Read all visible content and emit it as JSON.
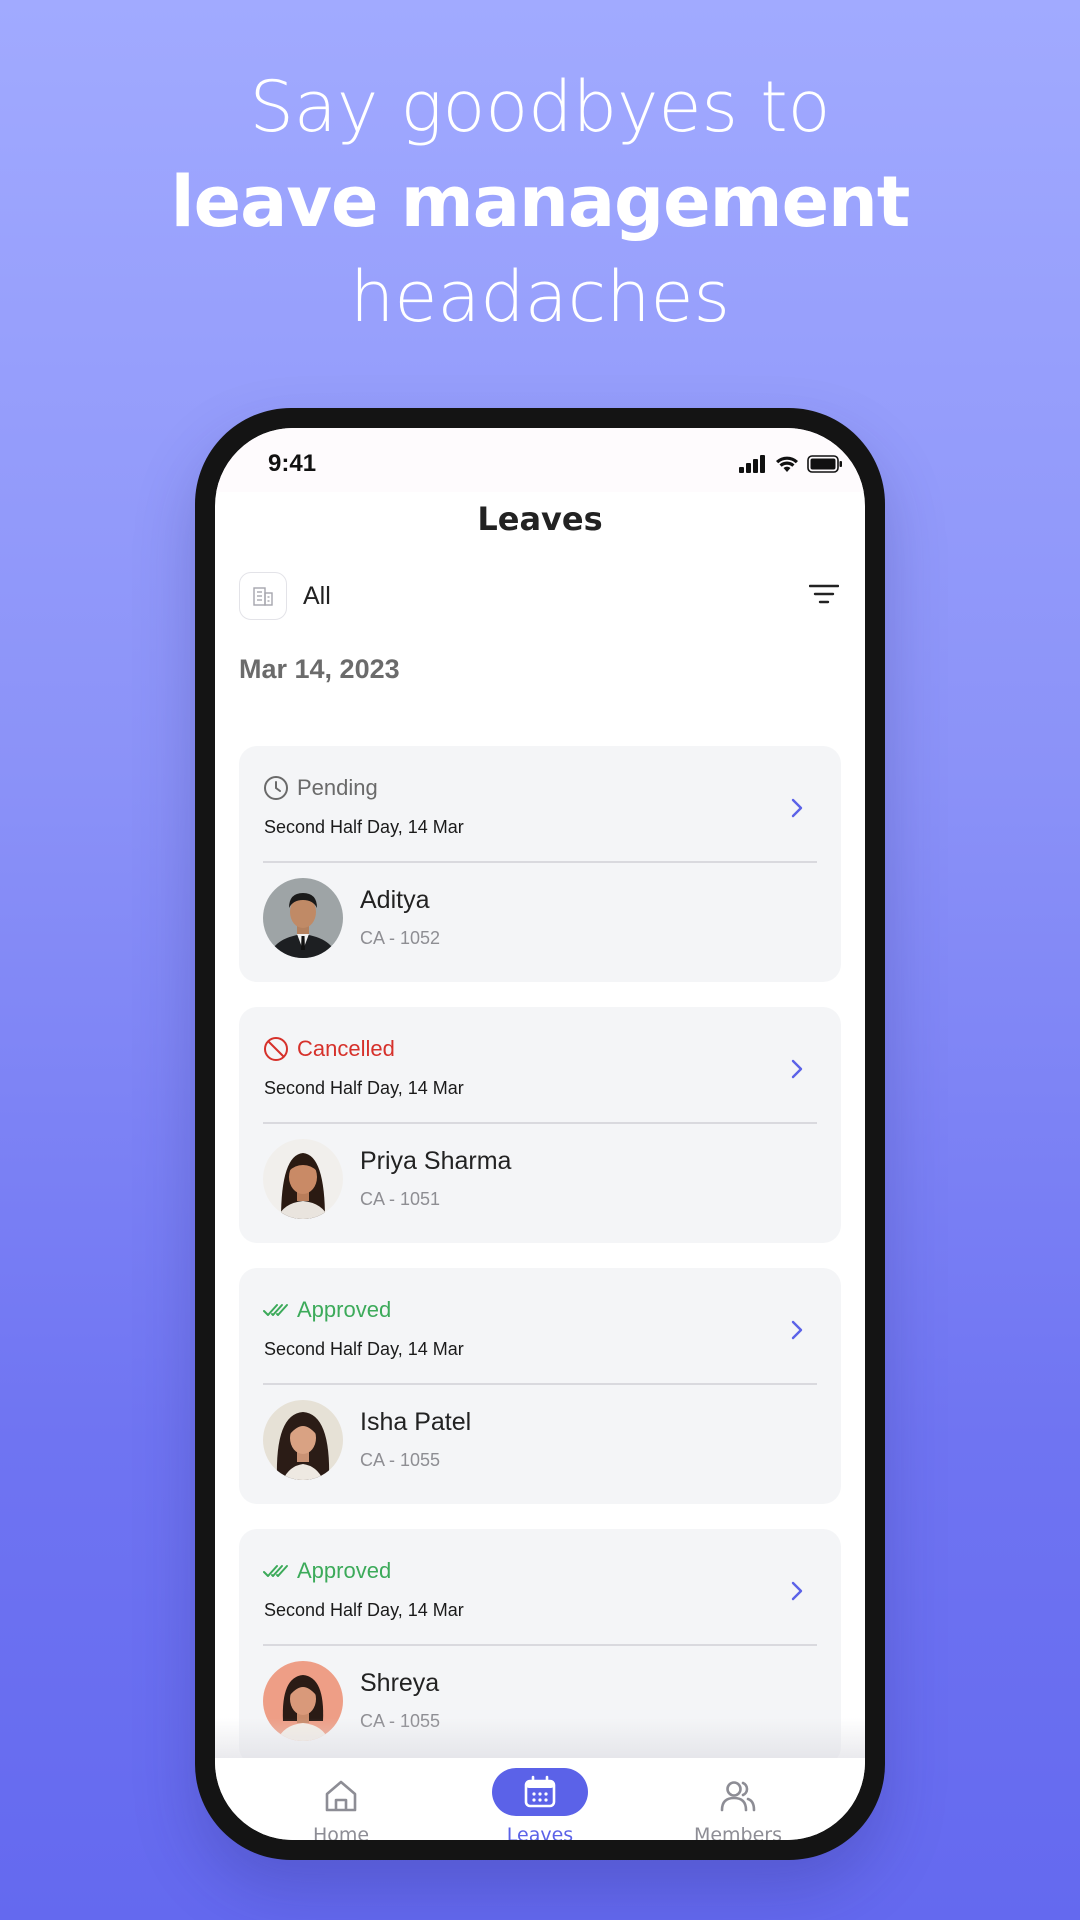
{
  "headline": {
    "line1": "Say goodbyes to",
    "line2": "leave management",
    "line3": "headaches"
  },
  "status_bar": {
    "time": "9:41"
  },
  "screen": {
    "title": "Leaves",
    "filter": {
      "label": "All",
      "building_icon": "building-icon",
      "filter_icon": "filter-icon"
    },
    "date": "Mar 14, 2023"
  },
  "cards": [
    {
      "status": "Pending",
      "status_icon": "clock-icon",
      "when": "Second Half Day, 14 Mar",
      "name": "Aditya",
      "id": "CA - 1052"
    },
    {
      "status": "Cancelled",
      "status_icon": "ban-icon",
      "when": "Second Half Day, 14 Mar",
      "name": "Priya Sharma",
      "id": "CA - 1051"
    },
    {
      "status": "Approved",
      "status_icon": "double-check-icon",
      "when": "Second Half Day, 14 Mar",
      "name": "Isha Patel",
      "id": "CA - 1055"
    },
    {
      "status": "Approved",
      "status_icon": "double-check-icon",
      "when": "Second Half Day, 14 Mar",
      "name": "Shreya",
      "id": "CA - 1055"
    }
  ],
  "bottom_nav": [
    {
      "label": "Home",
      "icon": "home-icon",
      "active": false
    },
    {
      "label": "Leaves",
      "icon": "calendar-icon",
      "active": true
    },
    {
      "label": "Members",
      "icon": "users-icon",
      "active": false
    }
  ],
  "colors": {
    "accent": "#5b62e8",
    "pending": "#6a6a6a",
    "cancelled": "#d6312b",
    "approved": "#3caa5a"
  }
}
